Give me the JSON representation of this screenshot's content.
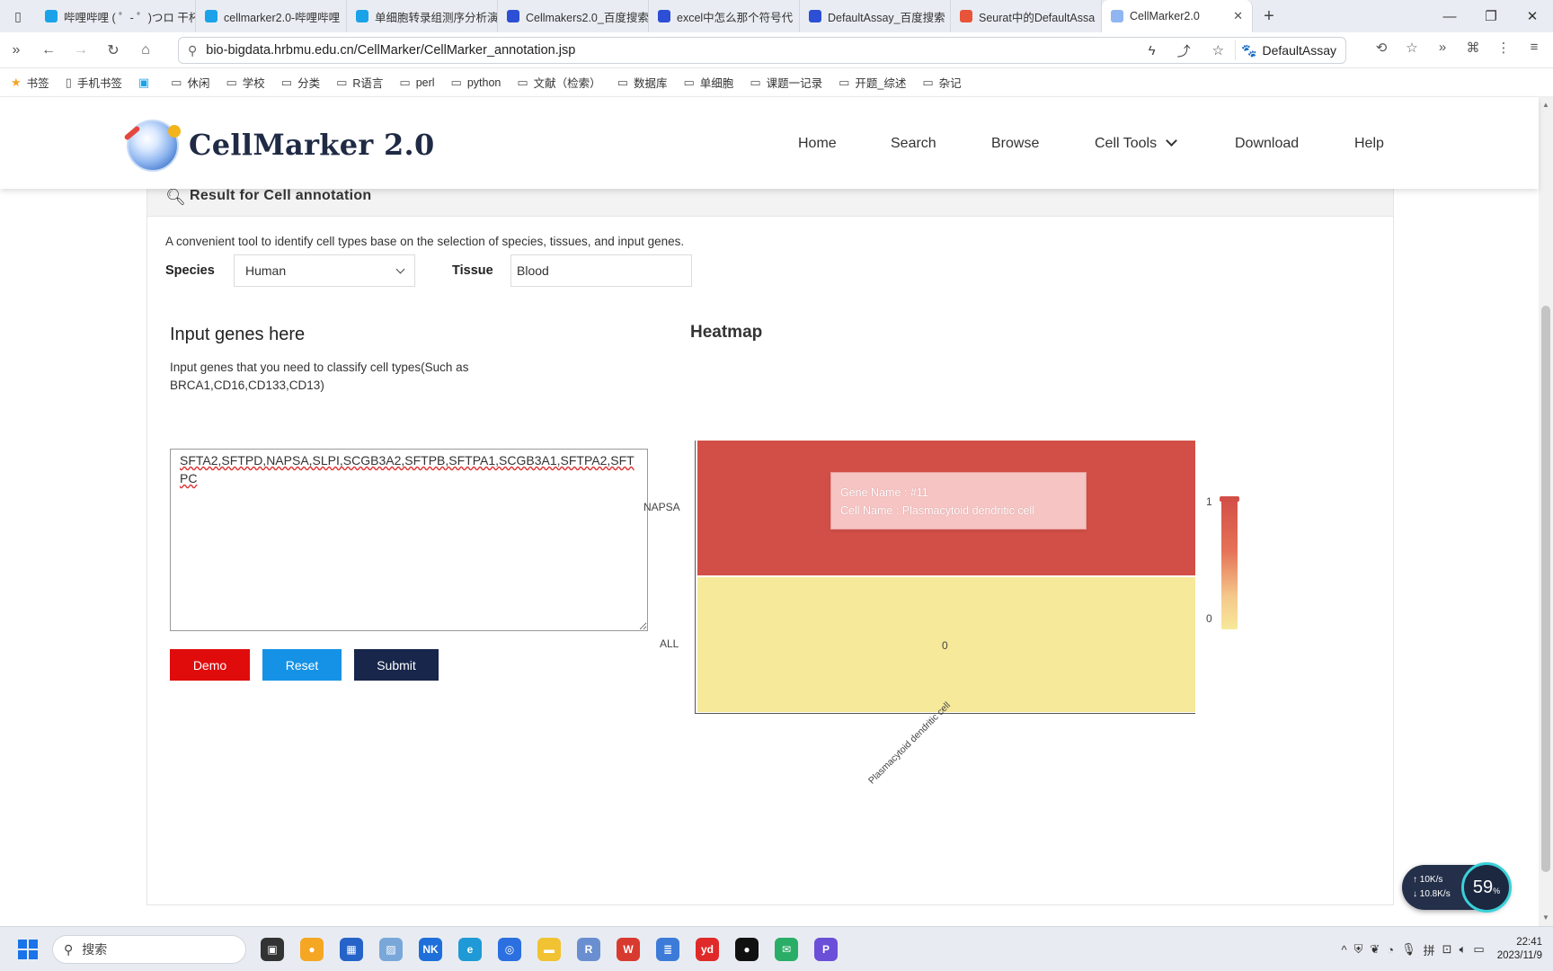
{
  "browser": {
    "tabs": [
      {
        "title": "哔哩哔哩 ( ゜- ゜)つロ 干杯",
        "fav_color": "#1aa3e8"
      },
      {
        "title": "cellmarker2.0-哔哩哔哩",
        "fav_color": "#1aa3e8"
      },
      {
        "title": "单细胞转录组测序分析演",
        "fav_color": "#1aa3e8"
      },
      {
        "title": "Cellmakers2.0_百度搜索",
        "fav_color": "#2c4fd6"
      },
      {
        "title": "excel中怎么那个符号代",
        "fav_color": "#2c4fd6"
      },
      {
        "title": "DefaultAssay_百度搜索",
        "fav_color": "#2c4fd6"
      },
      {
        "title": "Seurat中的DefaultAssa",
        "fav_color": "#e8543a"
      },
      {
        "title": "CellMarker2.0",
        "fav_color": "#8fb6f0",
        "active": true
      }
    ],
    "url": "bio-bigdata.hrbmu.edu.cn/CellMarker/CellMarker_annotation.jsp",
    "search_engine_label": "DefaultAssay",
    "bookmarks": [
      "书签",
      "手机书签",
      "休闲",
      "学校",
      "分类",
      "R语言",
      "perl",
      "python",
      "文献（检索）",
      "数据库",
      "单细胞",
      "课题一记录",
      "开题_综述",
      "杂记"
    ]
  },
  "site": {
    "logo_text": "CellMarker 2.0",
    "nav": {
      "home": "Home",
      "search": "Search",
      "browse": "Browse",
      "cell_tools": "Cell Tools",
      "download": "Download",
      "help": "Help"
    }
  },
  "annotation": {
    "header_title": "Result for Cell annotation",
    "description": "A convenient tool to identify cell types base on the selection of species, tissues, and input genes.",
    "species_label": "Species",
    "species_value": "Human",
    "tissue_label": "Tissue",
    "tissue_value": "Blood",
    "input_title": "Input genes here",
    "input_help": "Input genes that you need to classify cell types(Such as BRCA1,CD16,CD133,CD13)",
    "genes_value": "SFTA2,SFTPD,NAPSA,SLPI,SCGB3A2,SFTPB,SFTPA1,SCGB3A1,SFTPA2,SFTPC",
    "demo_label": "Demo",
    "reset_label": "Reset",
    "submit_label": "Submit",
    "heatmap_title": "Heatmap",
    "tooltip_gene": "Gene Name : #11",
    "tooltip_cell": "Cell Name : Plasmacytoid dendritic cell"
  },
  "chart_data": {
    "type": "heatmap",
    "title": "Heatmap",
    "x_categories": [
      "Plasmacytoid dendritic cell"
    ],
    "y_categories": [
      "NAPSA",
      "ALL"
    ],
    "values": [
      [
        1
      ],
      [
        0
      ]
    ],
    "cell_labels": [
      [
        ""
      ],
      [
        "0"
      ]
    ],
    "colorscale": {
      "min": 0,
      "max": 1,
      "low_color": "#f6e99a",
      "high_color": "#d24f47"
    },
    "colorbar_ticks": [
      "1",
      "0"
    ]
  },
  "system": {
    "net_up": "10K/s",
    "net_down": "10.8K/s",
    "cpu_percent": "59",
    "taskbar_search": "搜索",
    "time": "22:41",
    "date": "2023/11/9"
  }
}
